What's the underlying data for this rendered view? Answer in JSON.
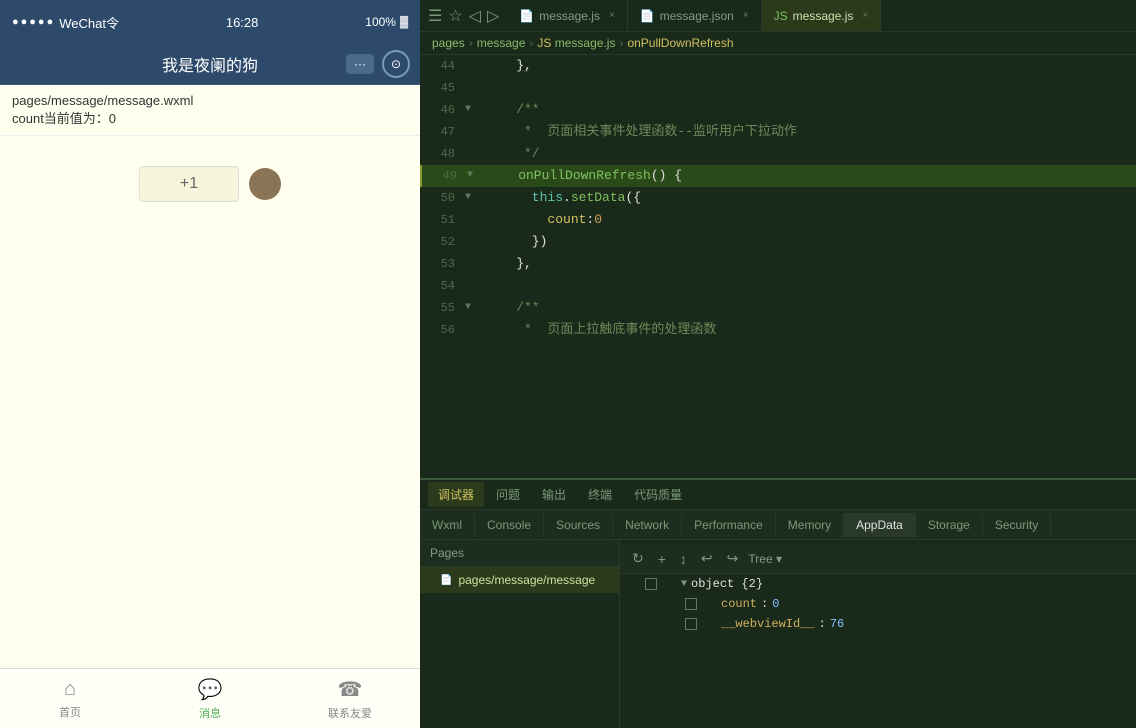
{
  "phone": {
    "status_bar": {
      "dots": "●●●●●",
      "carrier": "WeChat令",
      "time": "16:28",
      "battery_pct": "100%",
      "battery_icon": "▓"
    },
    "title": "我是夜阑的狗",
    "nav": {
      "items": [
        {
          "label": "首页",
          "icon": "⌂",
          "active": false
        },
        {
          "label": "消息",
          "icon": "💬",
          "active": true
        },
        {
          "label": "联系友爱",
          "icon": "☎",
          "active": false
        }
      ]
    },
    "page_info": "pages/message/message.wxml",
    "count_label": "count当前值为：0",
    "counter_btn": "+1"
  },
  "editor": {
    "tabs": [
      {
        "label": "▶",
        "active": false
      },
      {
        "label": "⊳",
        "active": false
      },
      {
        "label": "◁",
        "active": false
      },
      {
        "label": "▷",
        "active": false
      },
      {
        "label": "■ message.js",
        "active": true
      },
      {
        "label": "message.json",
        "active": false
      },
      {
        "label": "message.js ×",
        "active": false
      }
    ],
    "breadcrumb": {
      "parts": [
        "pages",
        "message",
        "message.js",
        "onPullDownRefresh"
      ]
    },
    "lines": [
      {
        "num": 44,
        "fold": "",
        "content": "    },"
      },
      {
        "num": 45,
        "fold": "",
        "content": ""
      },
      {
        "num": 46,
        "fold": "▼",
        "content": "    /**"
      },
      {
        "num": 47,
        "fold": "",
        "content": "     *  页面相关事件处理函数--监听用户下拉动作"
      },
      {
        "num": 48,
        "fold": "",
        "content": "     */"
      },
      {
        "num": 49,
        "fold": "▼",
        "content": "    onPullDownRefresh() {",
        "highlight": true
      },
      {
        "num": 50,
        "fold": "▼",
        "content": "      this.setData({"
      },
      {
        "num": 51,
        "fold": "",
        "content": "        count:0"
      },
      {
        "num": 52,
        "fold": "",
        "content": "      })"
      },
      {
        "num": 53,
        "fold": "",
        "content": "    },"
      },
      {
        "num": 54,
        "fold": "",
        "content": ""
      },
      {
        "num": 55,
        "fold": "▼",
        "content": "    /**"
      },
      {
        "num": 56,
        "fold": "",
        "content": "     *  页面上拉触底事件的处理函数"
      }
    ]
  },
  "debug": {
    "top_tabs": [
      "调试器",
      "问题",
      "输出",
      "终端",
      "代码质量"
    ],
    "bottom_tabs": [
      "Wxml",
      "Console",
      "Sources",
      "Network",
      "Performance",
      "Memory",
      "AppData",
      "Storage",
      "Security"
    ],
    "active_top_tab": "调试器",
    "active_bottom_tab": "AppData",
    "toolbar": {
      "refresh": "↻",
      "add": "+",
      "expand": "↕",
      "undo": "↩",
      "redo": "↪",
      "tree_label": "Tree"
    },
    "pages": {
      "header": "Pages",
      "items": [
        {
          "label": "pages/message/message",
          "active": true
        }
      ]
    },
    "data_tree": {
      "root": "object {2}",
      "entries": [
        {
          "key": "count",
          "value": "0",
          "type": "num",
          "indent": 3
        },
        {
          "key": "__webviewId__",
          "value": "76",
          "type": "num",
          "indent": 3
        }
      ]
    }
  }
}
